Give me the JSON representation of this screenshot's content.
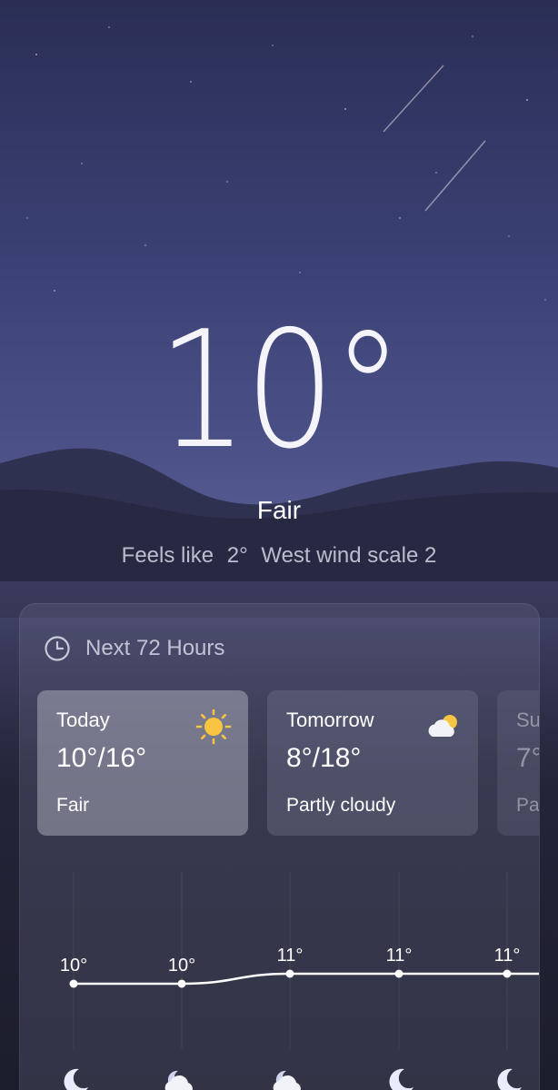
{
  "current": {
    "temperature": "10°",
    "condition": "Fair",
    "feels_like_label": "Feels like",
    "feels_like_value": "2°",
    "wind": "West wind scale 2"
  },
  "forecast_panel": {
    "title": "Next 72 Hours",
    "clock_icon": "clock-icon",
    "days": [
      {
        "day": "Today",
        "range": "10°/16°",
        "condition": "Fair",
        "icon": "sun-icon"
      },
      {
        "day": "Tomorrow",
        "range": "8°/18°",
        "condition": "Partly cloudy",
        "icon": "partly-cloudy-icon"
      },
      {
        "day": "Su",
        "range": "7°",
        "condition": "Pa",
        "icon": ""
      }
    ]
  },
  "hourly": {
    "temps": [
      "10°",
      "10°",
      "11°",
      "11°",
      "11°"
    ],
    "values": [
      10,
      10,
      11,
      11,
      11
    ],
    "icons": [
      "moon-icon",
      "cloudy-night-icon",
      "cloudy-night-icon",
      "moon-icon",
      "moon-icon"
    ]
  },
  "colors": {
    "sun": "#f7c542",
    "accent_text": "#ffffff"
  }
}
